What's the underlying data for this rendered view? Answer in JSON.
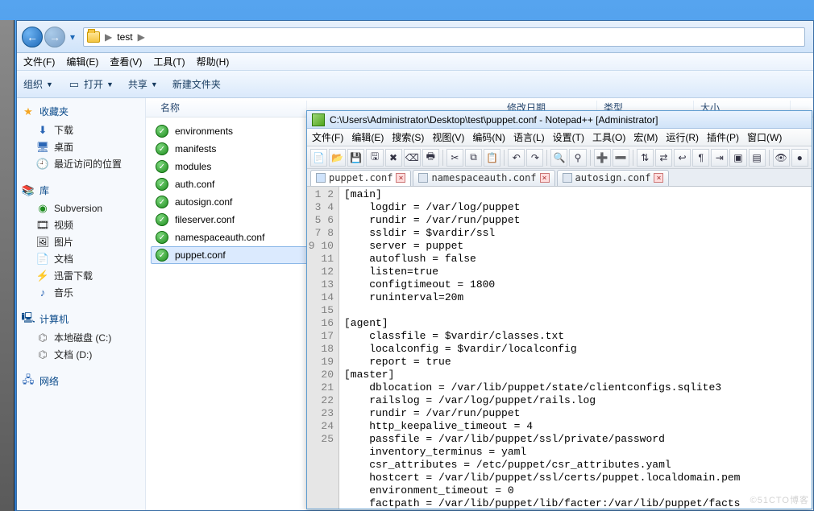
{
  "explorer": {
    "breadcrumb": {
      "root": "test"
    },
    "menu": [
      "文件(F)",
      "编辑(E)",
      "查看(V)",
      "工具(T)",
      "帮助(H)"
    ],
    "toolbar": {
      "organize": "组织",
      "open": "打开",
      "share": "共享",
      "new_folder": "新建文件夹"
    },
    "columns": {
      "name": "名称",
      "modified": "修改日期",
      "type": "类型",
      "size": "大小"
    },
    "sidebar": {
      "favorites": {
        "label": "收藏夹",
        "items": [
          "下载",
          "桌面",
          "最近访问的位置"
        ]
      },
      "libraries": {
        "label": "库",
        "items": [
          "Subversion",
          "视频",
          "图片",
          "文档",
          "迅雷下载",
          "音乐"
        ]
      },
      "computer": {
        "label": "计算机",
        "items": [
          "本地磁盘 (C:)",
          "文档 (D:)"
        ]
      },
      "network": {
        "label": "网络"
      }
    },
    "files": [
      {
        "name": "environments",
        "type": "folder"
      },
      {
        "name": "manifests",
        "type": "folder"
      },
      {
        "name": "modules",
        "type": "folder"
      },
      {
        "name": "auth.conf",
        "type": "file"
      },
      {
        "name": "autosign.conf",
        "type": "file"
      },
      {
        "name": "fileserver.conf",
        "type": "file"
      },
      {
        "name": "namespaceauth.conf",
        "type": "file"
      },
      {
        "name": "puppet.conf",
        "type": "file",
        "selected": true
      }
    ]
  },
  "npp": {
    "title": "C:\\Users\\Administrator\\Desktop\\test\\puppet.conf - Notepad++ [Administrator]",
    "menu": [
      "文件(F)",
      "编辑(E)",
      "搜索(S)",
      "视图(V)",
      "编码(N)",
      "语言(L)",
      "设置(T)",
      "工具(O)",
      "宏(M)",
      "运行(R)",
      "插件(P)",
      "窗口(W)"
    ],
    "tabs": [
      {
        "label": "puppet.conf",
        "active": true
      },
      {
        "label": "namespaceauth.conf",
        "active": false
      },
      {
        "label": "autosign.conf",
        "active": false
      }
    ],
    "toolbar_icons": [
      "new-icon",
      "open-icon",
      "save-icon",
      "save-all-icon",
      "close-icon",
      "close-all-icon",
      "print-icon",
      "sep",
      "cut-icon",
      "copy-icon",
      "paste-icon",
      "sep",
      "undo-icon",
      "redo-icon",
      "sep",
      "find-icon",
      "replace-icon",
      "sep",
      "zoom-in-icon",
      "zoom-out-icon",
      "sep",
      "sync-v-icon",
      "sync-h-icon",
      "wrap-icon",
      "all-chars-icon",
      "indent-icon",
      "fold-icon",
      "unfold-icon",
      "sep",
      "hide-lines-icon",
      "macro-record-icon"
    ],
    "toolbar_glyphs": {
      "new-icon": "📄",
      "open-icon": "📂",
      "save-icon": "💾",
      "save-all-icon": "🖫",
      "close-icon": "✖",
      "close-all-icon": "⌫",
      "print-icon": "🖶",
      "cut-icon": "✂",
      "copy-icon": "⧉",
      "paste-icon": "📋",
      "undo-icon": "↶",
      "redo-icon": "↷",
      "find-icon": "🔍",
      "replace-icon": "⚲",
      "zoom-in-icon": "➕",
      "zoom-out-icon": "➖",
      "sync-v-icon": "⇅",
      "sync-h-icon": "⇄",
      "wrap-icon": "↩",
      "all-chars-icon": "¶",
      "indent-icon": "⇥",
      "fold-icon": "▣",
      "unfold-icon": "▤",
      "hide-lines-icon": "👁",
      "macro-record-icon": "●"
    },
    "code_lines": [
      "[main]",
      "    logdir = /var/log/puppet",
      "    rundir = /var/run/puppet",
      "    ssldir = $vardir/ssl",
      "    server = puppet",
      "    autoflush = false",
      "    listen=true",
      "    configtimeout = 1800",
      "    runinterval=20m",
      "",
      "[agent]",
      "    classfile = $vardir/classes.txt",
      "    localconfig = $vardir/localconfig",
      "    report = true",
      "[master]",
      "    dblocation = /var/lib/puppet/state/clientconfigs.sqlite3",
      "    railslog = /var/log/puppet/rails.log",
      "    rundir = /var/run/puppet",
      "    http_keepalive_timeout = 4",
      "    passfile = /var/lib/puppet/ssl/private/password",
      "    inventory_terminus = yaml",
      "    csr_attributes = /etc/puppet/csr_attributes.yaml",
      "    hostcert = /var/lib/puppet/ssl/certs/puppet.localdomain.pem",
      "    environment_timeout = 0",
      "    factpath = /var/lib/puppet/lib/facter:/var/lib/puppet/facts"
    ]
  },
  "watermark": "©51CTO博客"
}
